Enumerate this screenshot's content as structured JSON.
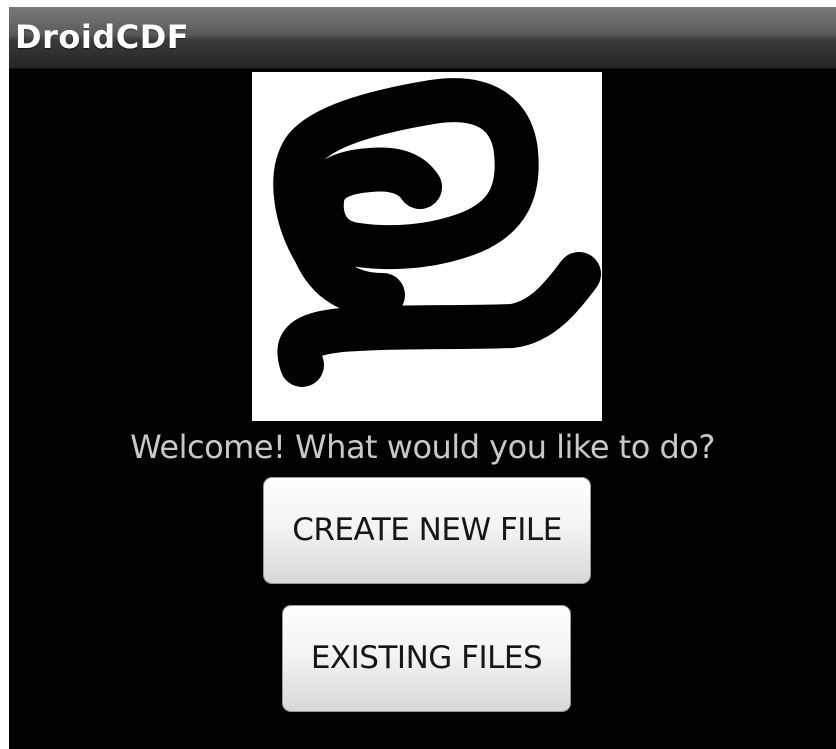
{
  "app": {
    "title": "DroidCDF"
  },
  "logo": {
    "icon": "spiral-logo-icon",
    "background_color": "#ffffff",
    "stroke_color": "#000000"
  },
  "main": {
    "welcome_text": "Welcome! What would you like to do?",
    "buttons": {
      "create_label": "CREATE NEW FILE",
      "existing_label": "EXISTING FILES"
    }
  },
  "colors": {
    "screen_background": "#000000",
    "welcome_text": "#c8c8c8",
    "button_text": "#161616"
  }
}
